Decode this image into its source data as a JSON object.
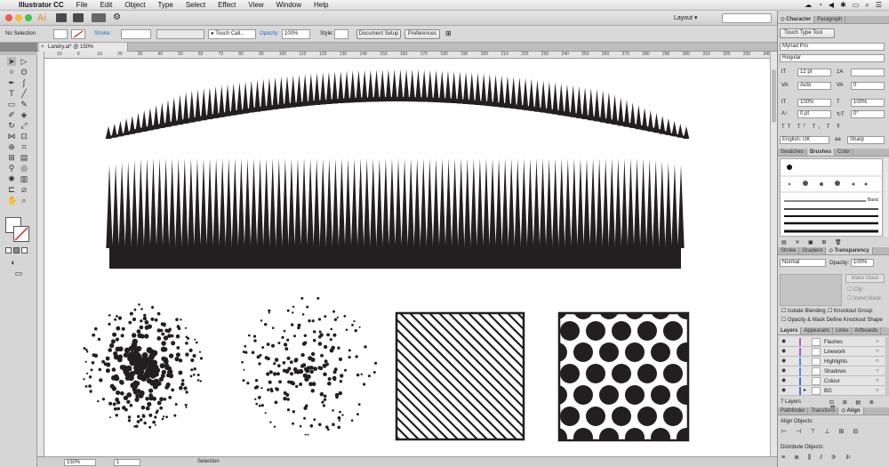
{
  "menubar": {
    "app": "Illustrator CC",
    "items": [
      "File",
      "Edit",
      "Object",
      "Type",
      "Select",
      "Effect",
      "View",
      "Window",
      "Help"
    ]
  },
  "appbar": {
    "logo": "Ai",
    "layout_label": "Layout"
  },
  "control": {
    "selection": "No Selection",
    "stroke_label": "Stroke:",
    "brush": "Touch Call...",
    "opacity_label": "Opacity:",
    "opacity_value": "100%",
    "style_label": "Style:",
    "document_setup": "Document Setup",
    "preferences": "Preferences"
  },
  "document": {
    "tab_title": "Landry.ai* @ 150% (CMYK/Preview)"
  },
  "ruler": {
    "ticks": [
      "10",
      "0",
      "10",
      "20",
      "30",
      "40",
      "50",
      "60",
      "70",
      "80",
      "90",
      "100",
      "110",
      "120",
      "130",
      "140",
      "150",
      "160",
      "170",
      "180",
      "190",
      "200",
      "210",
      "220",
      "230",
      "240",
      "250",
      "260",
      "270",
      "280",
      "290",
      "300",
      "310",
      "320",
      "330",
      "340"
    ]
  },
  "status": {
    "zoom": "150%",
    "page": "1",
    "tool": "Selection"
  },
  "character": {
    "tabs": [
      "Character",
      "Paragraph"
    ],
    "touch_type": "Touch Type Tool",
    "font": "Myriad Pro",
    "style": "Regular",
    "size": "12 pt",
    "leading": "Auto",
    "kerning": "",
    "tracking": "0",
    "vscale": "100%",
    "hscale": "100%",
    "baseline": "0 pt",
    "rotation": "0°",
    "language": "English: UK",
    "antialias": "Sharp"
  },
  "swatches": {
    "tabs": [
      "Swatches",
      "Brushes",
      "Color"
    ],
    "basic_label": "Basic"
  },
  "transparency": {
    "tabs": [
      "Stroke",
      "Gradient",
      "Transparency"
    ],
    "blend": "Normal",
    "opacity_label": "Opacity:",
    "opacity": "100%",
    "make_mask": "Make Mask",
    "clip": "Clip",
    "invert_mask": "Invert Mask",
    "isolate": "Isolate Blending",
    "knockout": "Knockout Group",
    "opacity_mask": "Opacity & Mask Define Knockout Shape"
  },
  "layers": {
    "tabs": [
      "Layers",
      "Appearanc",
      "Links",
      "Artboards"
    ],
    "items": [
      {
        "name": "Flashes",
        "color": "#c05ab8"
      },
      {
        "name": "Linework",
        "color": "#9a5ad0"
      },
      {
        "name": "Highlights",
        "color": "#4a8fd8"
      },
      {
        "name": "Shadows",
        "color": "#4a8fd8"
      },
      {
        "name": "Colour",
        "color": "#4a6fd8"
      },
      {
        "name": "BG",
        "color": "#4a6fd8"
      }
    ],
    "count": "7 Layers"
  },
  "align": {
    "tabs": [
      "Pathfinder",
      "Transform",
      "Align"
    ],
    "align_objects": "Align Objects:",
    "distribute_objects": "Distribute Objects:"
  },
  "colors": {
    "accent": "#2a6ad0",
    "ink": "#231f20"
  }
}
